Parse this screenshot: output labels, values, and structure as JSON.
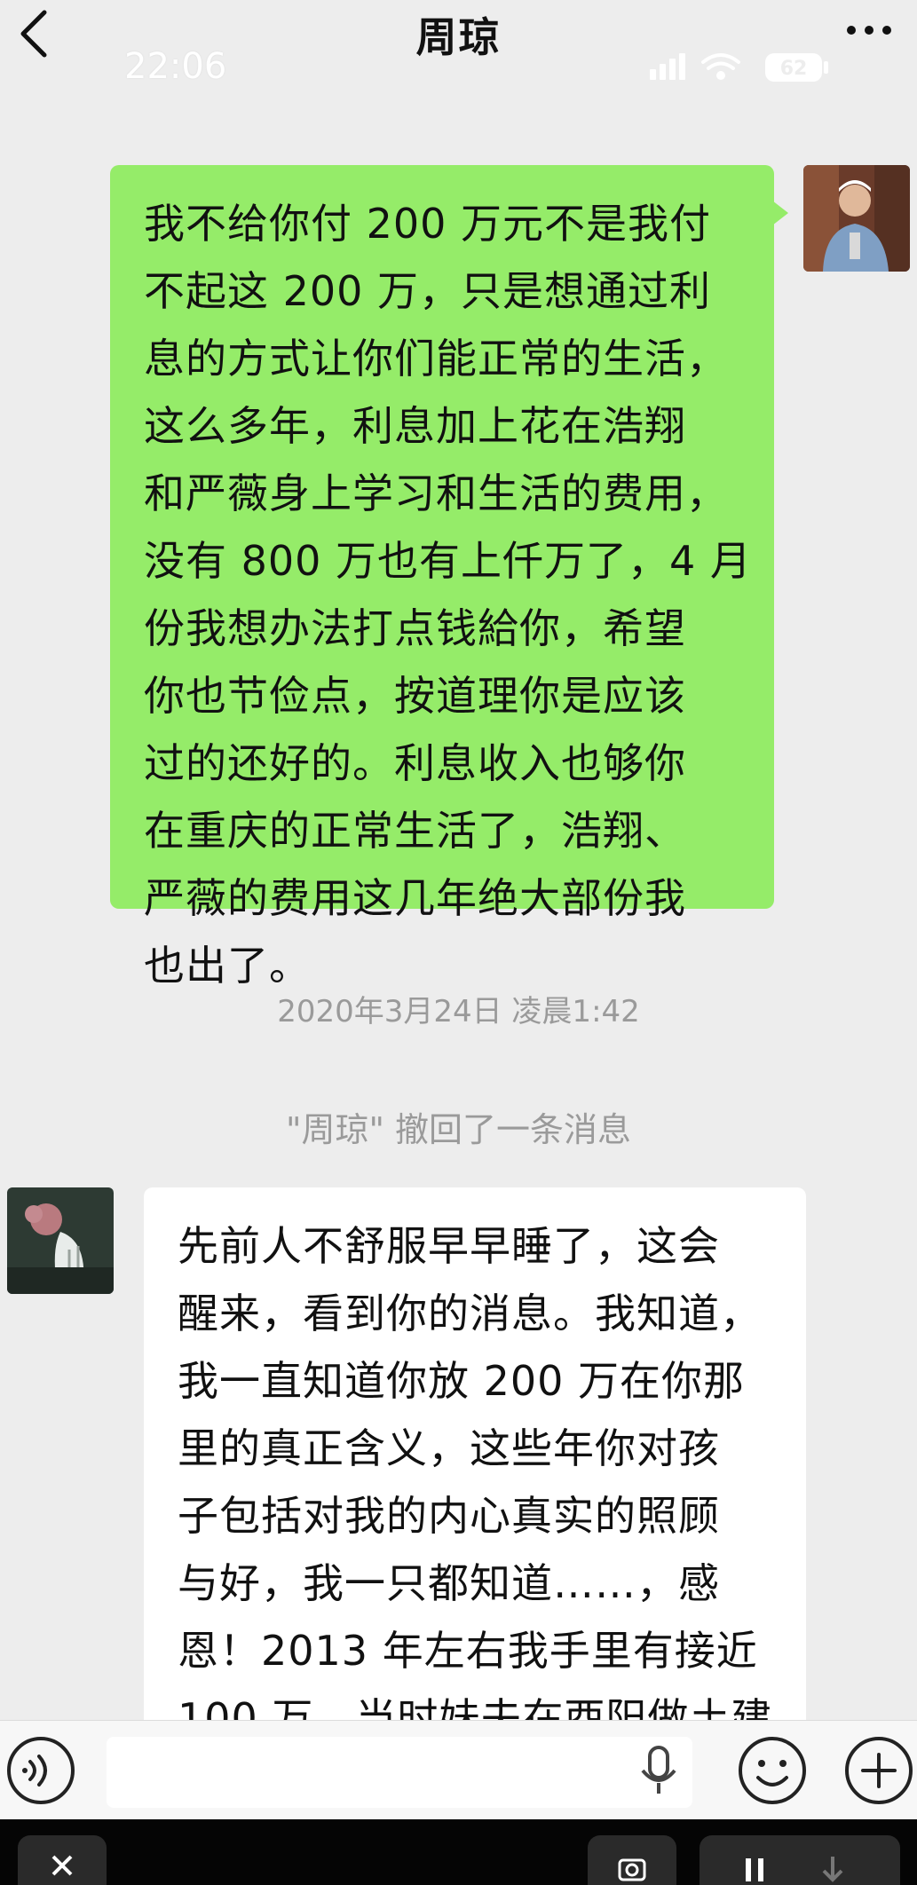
{
  "header": {
    "title": "周琼",
    "back_icon": "chevron-left-icon",
    "more_icon": "more-dots-icon"
  },
  "status_bar": {
    "time": "22:06",
    "battery": "62"
  },
  "messages": {
    "sent": {
      "text": "我不给你付 200 万元不是我付\n不起这 200 万，只是想通过利\n息的方式让你们能正常的生活，\n这么多年，利息加上花在浩翔\n和严薇身上学习和生活的费用，\n没有 800 万也有上仟万了，4 月\n份我想办法打点钱給你，希望\n你也节俭点，按道理你是应该\n过的还好的。利息收入也够你\n在重庆的正常生活了，浩翔、\n严薇的费用这几年绝大部份我\n也出了。",
      "bubble_color": "#95ec69"
    },
    "timestamp": "2020年3月24日 凌晨1:42",
    "recall_notice": "\"周琼\" 撤回了一条消息",
    "received": {
      "text": "先前人不舒服早早睡了，这会\n醒来，看到你的消息。我知道，\n我一直知道你放 200 万在你那\n里的真正含义，这些年你对孩\n子包括对我的内心真实的照顾\n与好，我一只都知道……，感\n恩！2013 年左右我手里有接近\n100 万，当时妹夫在酉阳做土建\n的时候情况还不错，我堂姐夫",
      "bubble_color": "#ffffff"
    }
  },
  "input_bar": {
    "icons": [
      "voice-icon",
      "microphone-icon",
      "emoji-icon",
      "plus-icon"
    ]
  }
}
